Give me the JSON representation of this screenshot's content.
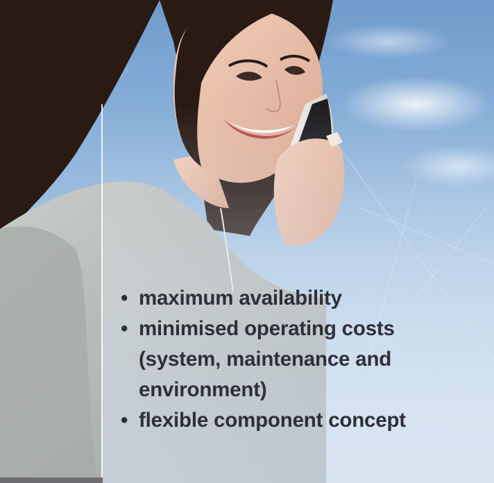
{
  "image": {
    "subject": "woman-talking-on-smartphone",
    "background": "sky-with-clouds",
    "colors": {
      "sky_top": "#6f9ccd",
      "sky_bottom": "#dbe6f0",
      "text": "#2f2f38",
      "jacket": "#b9bdb9",
      "hair": "#2a1a14"
    }
  },
  "bullets": [
    {
      "marker": "•",
      "text": "maximum availability"
    },
    {
      "marker": "•",
      "text": "minimised operating costs"
    },
    {
      "marker": "",
      "text": "(system, maintenance and"
    },
    {
      "marker": "",
      "text": "environment)"
    },
    {
      "marker": "•",
      "text": "flexible component concept"
    }
  ]
}
